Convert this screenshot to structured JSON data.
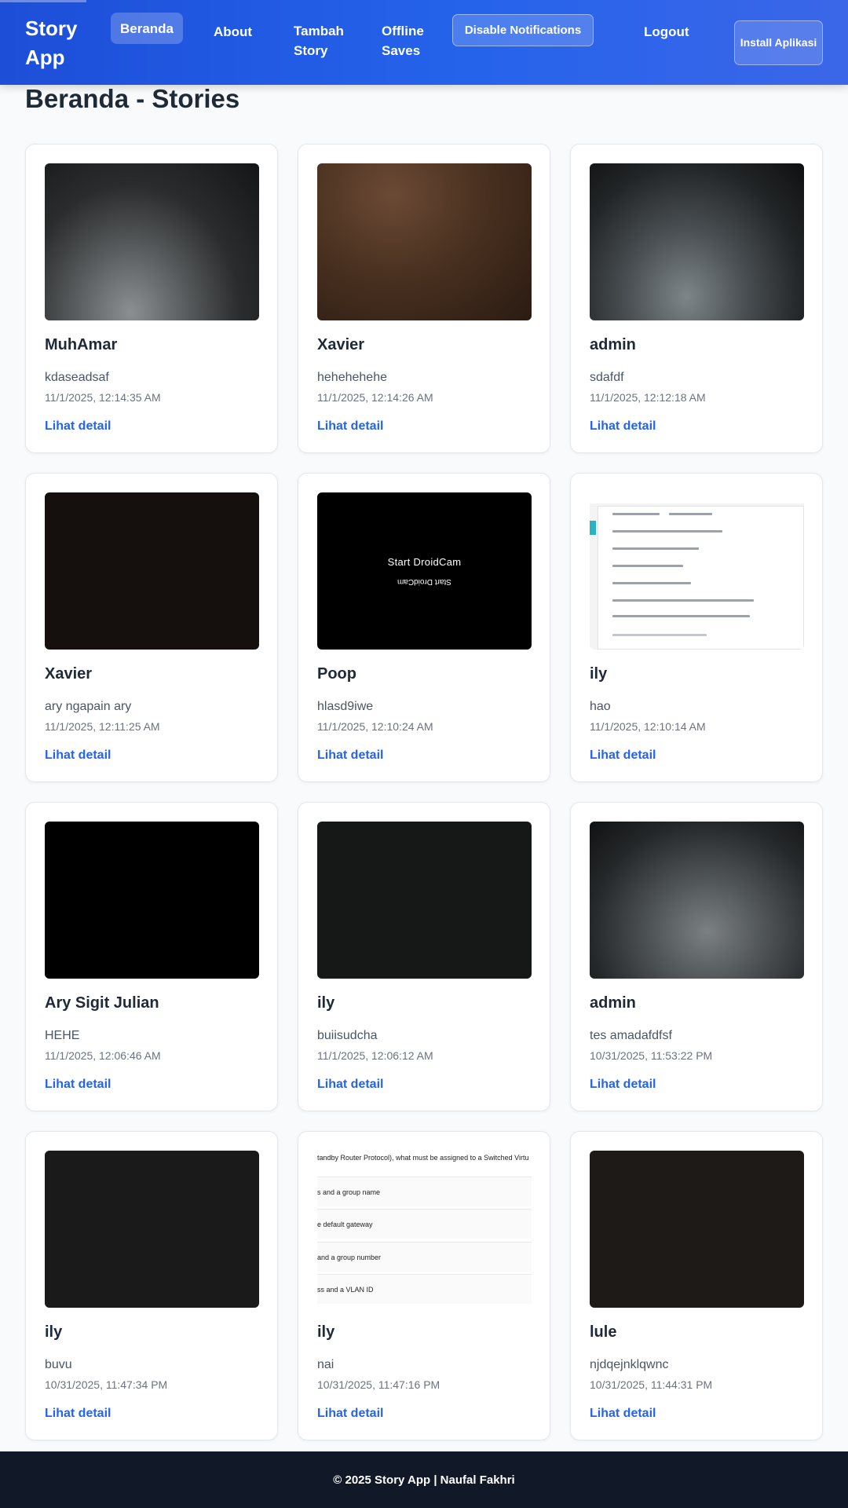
{
  "header": {
    "brand": "Story App",
    "nav": {
      "beranda": "Beranda",
      "about": "About",
      "tambah": "Tambah Story",
      "offline": "Offline Saves",
      "notif": "Disable Notifications",
      "logout": "Logout",
      "install": "Install Aplikasi"
    }
  },
  "page_title": "Beranda - Stories",
  "link_label": "Lihat detail",
  "stories": [
    {
      "name": "MuhAmar",
      "desc": "kdaseadsaf",
      "date": "11/1/2025, 12:14:35 AM"
    },
    {
      "name": "Xavier",
      "desc": "hehehehehe",
      "date": "11/1/2025, 12:14:26 AM"
    },
    {
      "name": "admin",
      "desc": "sdafdf",
      "date": "11/1/2025, 12:12:18 AM"
    },
    {
      "name": "Xavier",
      "desc": "ary ngapain ary",
      "date": "11/1/2025, 12:11:25 AM"
    },
    {
      "name": "Poop",
      "desc": "hlasd9iwe",
      "date": "11/1/2025, 12:10:24 AM",
      "image_text": [
        "Start DroidCam",
        "Start DroidCam"
      ]
    },
    {
      "name": "ily",
      "desc": "hao",
      "date": "11/1/2025, 12:10:14 AM"
    },
    {
      "name": "Ary Sigit Julian",
      "desc": "HEHE",
      "date": "11/1/2025, 12:06:46 AM"
    },
    {
      "name": "ily",
      "desc": "buiisudcha",
      "date": "11/1/2025, 12:06:12 AM"
    },
    {
      "name": "admin",
      "desc": "tes amadafdfsf",
      "date": "10/31/2025, 11:53:22 PM"
    },
    {
      "name": "ily",
      "desc": "buvu",
      "date": "10/31/2025, 11:47:34 PM"
    },
    {
      "name": "ily",
      "desc": "nai",
      "date": "10/31/2025, 11:47:16 PM",
      "image_text": [
        "tandby Router Protocol), what must be assigned to a Switched Virtu",
        "s and a group name",
        "e default gateway",
        "and a group number",
        "ss and a VLAN ID"
      ]
    },
    {
      "name": "lule",
      "desc": "njdqejnklqwnc",
      "date": "10/31/2025, 11:44:31 PM"
    }
  ],
  "footer": "© 2025 Story App | Naufal Fakhri"
}
